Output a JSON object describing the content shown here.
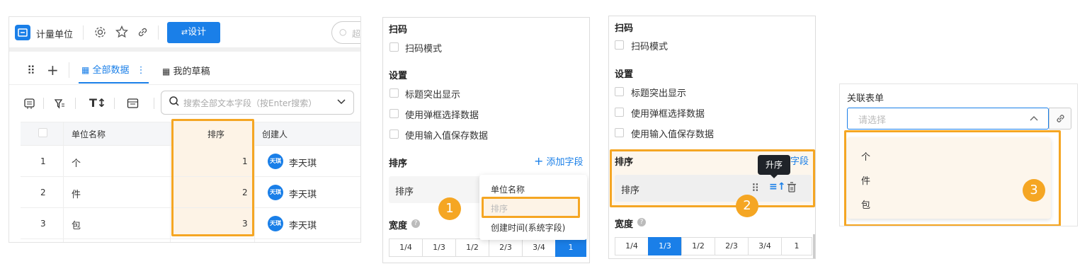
{
  "app": {
    "title": "计量单位",
    "design_label": "设计",
    "search_placeholder": "超"
  },
  "views": {
    "all_data": "全部数据",
    "drafts": "我的草稿",
    "search_placeholder": "搜索全部文本字段（按Enter搜索）"
  },
  "table": {
    "columns": [
      "单位名称",
      "排序",
      "创建人"
    ],
    "rows": [
      {
        "index": "1",
        "name": "个",
        "sort": "1",
        "avatar": "天琪",
        "creator": "李天琪"
      },
      {
        "index": "2",
        "name": "件",
        "sort": "2",
        "avatar": "天琪",
        "creator": "李天琪"
      },
      {
        "index": "3",
        "name": "包",
        "sort": "3",
        "avatar": "天琪",
        "creator": "李天琪"
      }
    ]
  },
  "settings": {
    "scan_title": "扫码",
    "scan_mode": "扫码模式",
    "settings_title": "设置",
    "options": [
      "标题突出显示",
      "使用弹框选择数据",
      "使用输入值保存数据"
    ],
    "sort_title": "排序",
    "add_field": "添加字段",
    "add_field_partial": "加字段",
    "sort_row_label": "排序",
    "width_title": "宽度",
    "width_options": [
      "1/4",
      "1/3",
      "1/2",
      "2/3",
      "3/4",
      "1"
    ]
  },
  "dropdown": {
    "items": [
      "单位名称",
      "排序",
      "创建时间(系统字段)"
    ]
  },
  "tooltip": {
    "ascending": "升序"
  },
  "form": {
    "label": "关联表单",
    "placeholder": "请选择",
    "options": [
      "个",
      "件",
      "包"
    ]
  },
  "badges": [
    "1",
    "2",
    "3"
  ],
  "colors": {
    "accent": "#1a7fe8",
    "highlight": "#f5a623"
  }
}
